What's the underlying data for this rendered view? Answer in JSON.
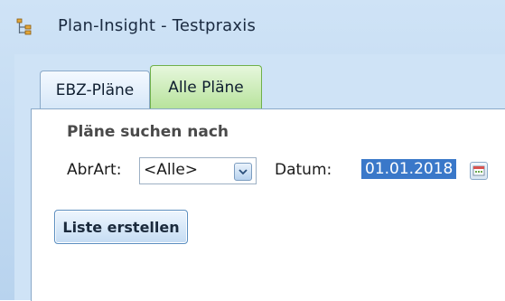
{
  "window": {
    "title": "Plan-Insight - Testpraxis"
  },
  "tabs": [
    {
      "label": "EBZ-Pläne",
      "active": false
    },
    {
      "label": "Alle Pläne",
      "active": true
    }
  ],
  "search": {
    "section_title": "Pläne suchen nach",
    "abrart_label": "AbrArt:",
    "abrart_value": "<Alle>",
    "datum_label": "Datum:",
    "datum_value": "01.01.2018"
  },
  "actions": {
    "create_list_label": "Liste erstellen"
  },
  "icons": {
    "app": "tree-icon",
    "dropdown": "chevron-down-icon",
    "calendar": "calendar-icon"
  },
  "colors": {
    "accent": "#3a78c9",
    "active_tab": "#b8e39c"
  }
}
